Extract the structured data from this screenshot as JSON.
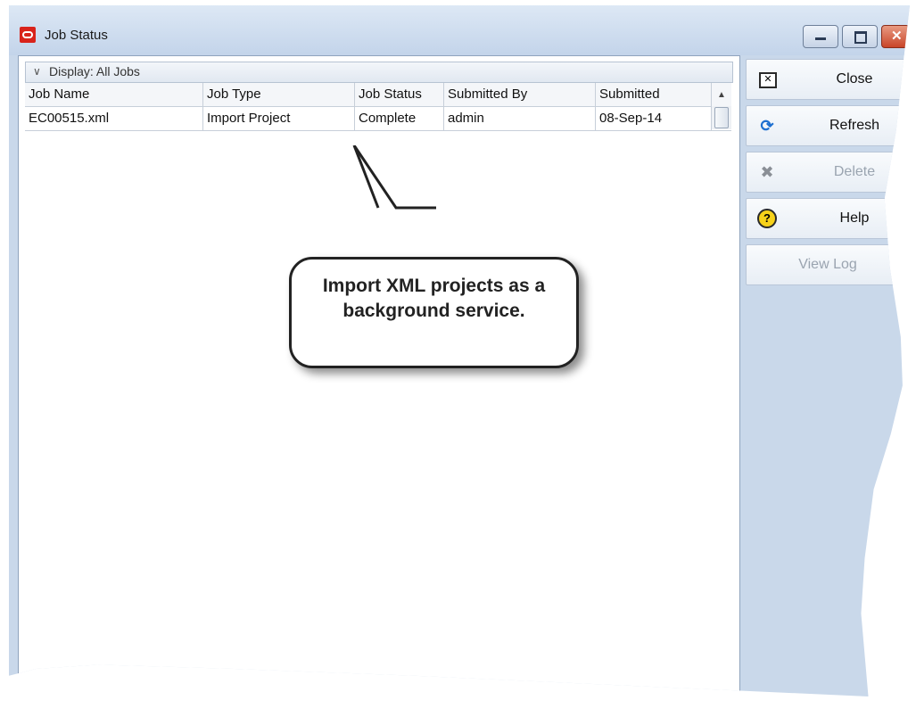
{
  "window": {
    "title": "Job Status"
  },
  "display_filter": {
    "label": "Display: All Jobs"
  },
  "table": {
    "columns": [
      "Job Name",
      "Job Type",
      "Job Status",
      "Submitted By",
      "Submitted"
    ],
    "rows": [
      [
        "EC00515.xml",
        "Import Project",
        "Complete",
        "admin",
        "08-Sep-14"
      ]
    ]
  },
  "callout": {
    "text": "Import XML projects as a background service."
  },
  "sidebar": {
    "close_label": "Close",
    "refresh_label": "Refresh",
    "delete_label": "Delete",
    "help_label": "Help",
    "viewlog_label": "View Log"
  },
  "colors": {
    "accent": "#d9231b",
    "title_bar": "#c3d4ea"
  }
}
